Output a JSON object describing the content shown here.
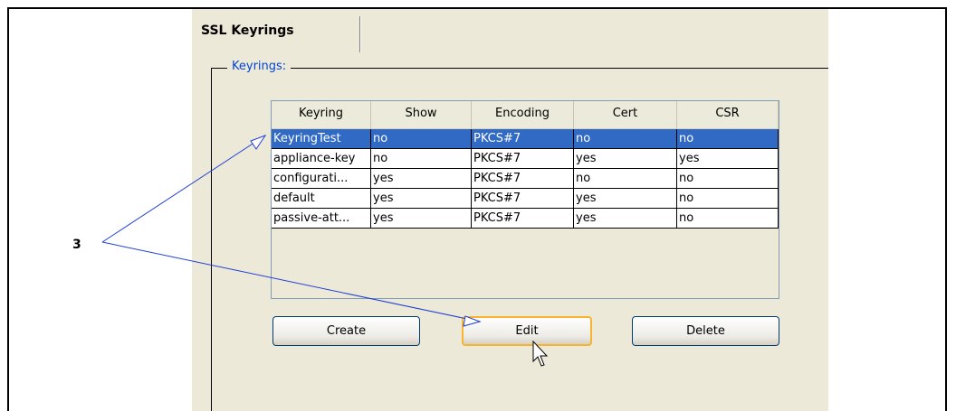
{
  "tab": {
    "label": "SSL Keyrings"
  },
  "groupbox": {
    "label": "Keyrings:"
  },
  "table": {
    "columns": [
      "Keyring",
      "Show",
      "Encoding",
      "Cert",
      "CSR"
    ],
    "rows": [
      [
        "KeyringTest",
        "no",
        "PKCS#7",
        "no",
        "no"
      ],
      [
        "appliance-key",
        "no",
        "PKCS#7",
        "yes",
        "yes"
      ],
      [
        "configurati...",
        "yes",
        "PKCS#7",
        "no",
        "no"
      ],
      [
        "default",
        "yes",
        "PKCS#7",
        "yes",
        "no"
      ],
      [
        "passive-att...",
        "yes",
        "PKCS#7",
        "yes",
        "no"
      ]
    ],
    "selected_row": 0
  },
  "buttons": {
    "create": "Create",
    "edit": "Edit",
    "delete": "Delete"
  },
  "callout": {
    "number": "3"
  },
  "colors": {
    "selection": "#316ac5",
    "accent_label": "#0046d5",
    "focus_ring": "#f8b330",
    "callout_line": "#1f3fd4"
  }
}
